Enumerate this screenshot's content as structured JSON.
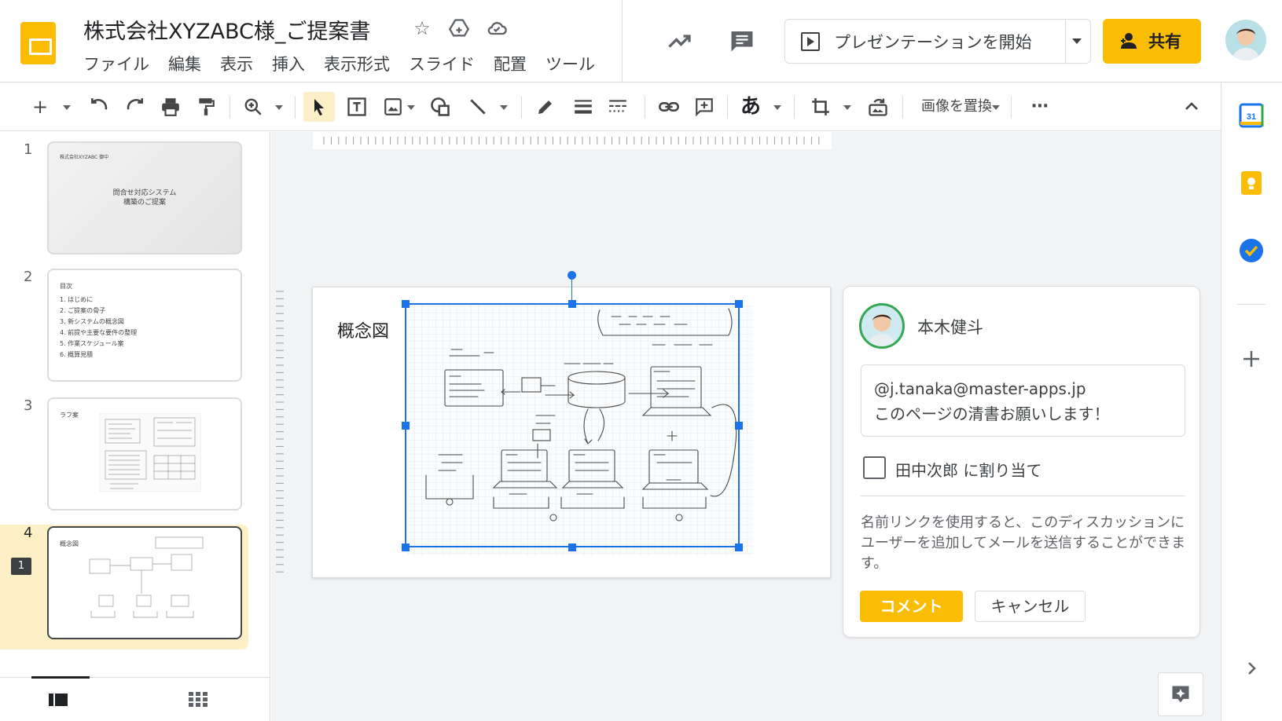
{
  "header": {
    "doc_title": "株式会社XYZABC様_ご提案書",
    "menu": [
      "ファイル",
      "編集",
      "表示",
      "挿入",
      "表示形式",
      "スライド",
      "配置",
      "ツール"
    ],
    "present_label": "プレゼンテーションを開始",
    "share_label": "共有"
  },
  "toolbar": {
    "replace_image_label": "画像を置換",
    "input_tools_glyph": "あ"
  },
  "filmstrip": {
    "slides": [
      {
        "number": "1",
        "lines": [
          "株式会社XYZABC 御中",
          "問合せ対応システム",
          "構築のご提案"
        ]
      },
      {
        "number": "2",
        "lines": [
          "目次",
          "1. はじめに",
          "2. ご提案の骨子",
          "3. 新システムの概念図",
          "4. 前提や主要な要件の整理",
          "5. 作業スケジュール案",
          "6. 概算見積"
        ]
      },
      {
        "number": "3",
        "lines": [
          "ラフ案"
        ]
      },
      {
        "number": "4",
        "lines": [
          "概念図"
        ],
        "comment_count": "1"
      }
    ]
  },
  "slide": {
    "title": "概念図"
  },
  "comment": {
    "author": "本木健斗",
    "text": "@j.tanaka@master-apps.jp\nこのページの清書お願いします！",
    "assign_label": "田中次郎 に割り当て",
    "info": "名前リンクを使用すると、このディスカッションにユーザーを追加してメールを送信することができます。",
    "submit_label": "コメント",
    "cancel_label": "キャンセル"
  },
  "colors": {
    "accent": "#fbbc04",
    "selection": "#1a73e8",
    "selected_slide_bg": "#fef0c6"
  }
}
